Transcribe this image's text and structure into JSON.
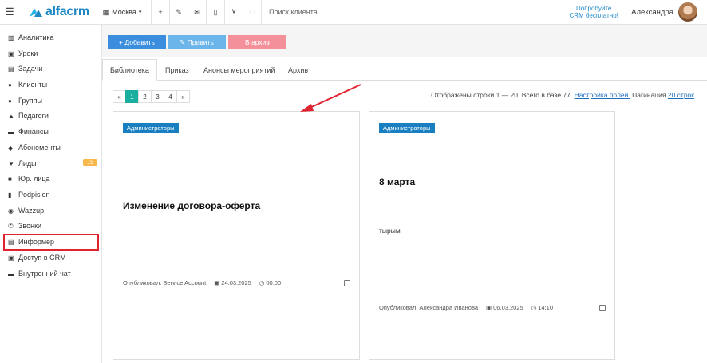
{
  "topbar": {
    "logo_text": "alfacrm",
    "city": "Москва",
    "search_placeholder": "Поиск клиента",
    "promo_line1": "Попробуйте",
    "promo_line2": "CRM бесплатно!",
    "user_name": "Александра"
  },
  "sidebar": {
    "items": [
      {
        "label": "Аналитика",
        "icon": "chart-icon"
      },
      {
        "label": "Уроки",
        "icon": "calendar-icon"
      },
      {
        "label": "Задачи",
        "icon": "tasks-icon"
      },
      {
        "label": "Клиенты",
        "icon": "user-icon"
      },
      {
        "label": "Группы",
        "icon": "users-icon"
      },
      {
        "label": "Педагоги",
        "icon": "graduation-cap-icon"
      },
      {
        "label": "Финансы",
        "icon": "money-icon"
      },
      {
        "label": "Абонементы",
        "icon": "tag-icon"
      },
      {
        "label": "Лиды",
        "icon": "funnel-icon",
        "badge": "19"
      },
      {
        "label": "Юр. лица",
        "icon": "building-icon"
      },
      {
        "label": "Podpislon",
        "icon": "document-icon"
      },
      {
        "label": "Wazzup",
        "icon": "whatsapp-icon"
      },
      {
        "label": "Звонки",
        "icon": "phone-icon"
      },
      {
        "label": "Информер",
        "icon": "list-icon"
      },
      {
        "label": "Доступ в CRM",
        "icon": "lock-icon"
      },
      {
        "label": "Внутренний чат",
        "icon": "chat-icon"
      }
    ]
  },
  "actions": {
    "add": "+ Добавить",
    "edit": "✎ Править",
    "archive": "В архив"
  },
  "tabs": [
    "Библиотека",
    "Приказ",
    "Анонсы мероприятий",
    "Архив"
  ],
  "pagination": {
    "prev": "«",
    "pages": [
      "1",
      "2",
      "3",
      "4"
    ],
    "next": "»",
    "info": "Отображены строки 1 — 20. Всего в базе 77.",
    "fields_link": "Настройка полей.",
    "pagination_label": "Пагинация",
    "per_page_link": "20 строк"
  },
  "cards": [
    {
      "tag": "Администраторы",
      "title": "Изменение договора-оферта",
      "body": "",
      "published": "Опубликовал: Service Account",
      "date": "24.03.2025",
      "time": "00:00"
    },
    {
      "tag": "Администраторы",
      "title": "8 марта",
      "body": "тырым",
      "published": "Опубликовал: Александра Иванова",
      "date": "06.03.2025",
      "time": "14:10"
    }
  ],
  "colors": {
    "brand": "#1e88c7",
    "add_button": "#3b8ede",
    "edit_button": "#6bb5ea",
    "archive_button": "#f3909a",
    "active_page": "#1aae9f",
    "highlight": "#e0242f",
    "tag": "#1a7fc1"
  }
}
